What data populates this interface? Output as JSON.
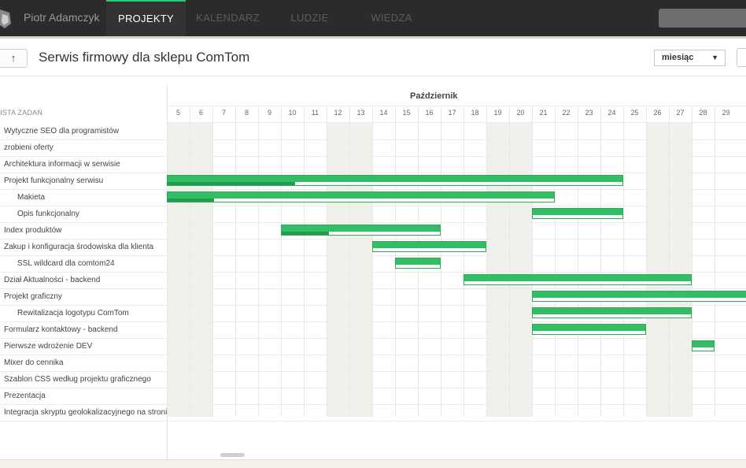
{
  "nav": {
    "user_name": "Piotr Adamczyk",
    "tabs": [
      {
        "label": "PROJEKTY",
        "active": true
      },
      {
        "label": "KALENDARZ",
        "active": false
      },
      {
        "label": "LUDZIE",
        "active": false
      },
      {
        "label": "WIEDZA",
        "active": false
      }
    ],
    "icons": {
      "logo": "logo-icon",
      "search": "search-box"
    },
    "accent": "#2ecc71"
  },
  "header": {
    "back_label": "↑",
    "title": "Serwis firmowy dla sklepu ComTom",
    "view_value": "miesiąc",
    "view_caret": "▼"
  },
  "gantt": {
    "list_header": "LISTA ZADAŃ",
    "month": "Październik",
    "days": [
      "5",
      "6",
      "7",
      "8",
      "9",
      "10",
      "11",
      "12",
      "13",
      "14",
      "15",
      "16",
      "17",
      "18",
      "19",
      "20",
      "21",
      "22",
      "23",
      "24",
      "25",
      "26",
      "27",
      "28",
      "29"
    ],
    "weekend_days": [
      "5",
      "6",
      "12",
      "13",
      "19",
      "20",
      "26",
      "27"
    ],
    "bar_color": "#32be64",
    "tasks": [
      {
        "label": "Wytyczne SEO dla programistów",
        "sub": false
      },
      {
        "label": "zrobieni oferty",
        "sub": false
      },
      {
        "label": "Architektura informacji w serwisie",
        "sub": false
      },
      {
        "label": "Projekt funkcjonalny serwisu",
        "sub": false,
        "start": 5,
        "end": 24,
        "progress": 0.28
      },
      {
        "label": "Makieta",
        "sub": true,
        "start": 5,
        "end": 21,
        "progress": 0.12
      },
      {
        "label": "Opis funkcjonalny",
        "sub": true,
        "start": 21,
        "end": 24,
        "progress": 0
      },
      {
        "label": "Index produktów",
        "sub": false,
        "start": 10,
        "end": 16,
        "progress": 0.3
      },
      {
        "label": "Zakup i konfiguracja środowiska dla klienta",
        "sub": false,
        "start": 14,
        "end": 18,
        "progress": 0
      },
      {
        "label": "SSL wildcard dla comtom24",
        "sub": true,
        "start": 15,
        "end": 16,
        "progress": 0
      },
      {
        "label": "Dział Aktualności - backend",
        "sub": false,
        "start": 18,
        "end": 27,
        "progress": 0
      },
      {
        "label": "Projekt graficzny",
        "sub": false,
        "start": 21,
        "end": 30,
        "progress": 0
      },
      {
        "label": "Rewitalizacja logotypu ComTom",
        "sub": true,
        "start": 21,
        "end": 27,
        "progress": 0
      },
      {
        "label": "Formularz kontaktowy - backend",
        "sub": false,
        "start": 21,
        "end": 25,
        "progress": 0
      },
      {
        "label": "Pierwsze wdrożenie DEV",
        "sub": false,
        "start": 28,
        "end": 28,
        "progress": 0
      },
      {
        "label": "Mixer do cennika",
        "sub": false
      },
      {
        "label": "Szablon CSS według projektu graficznego",
        "sub": false
      },
      {
        "label": "Prezentacja",
        "sub": false
      },
      {
        "label": "Integracja skryptu geolokalizacyjnego na stronie",
        "sub": false
      }
    ]
  }
}
